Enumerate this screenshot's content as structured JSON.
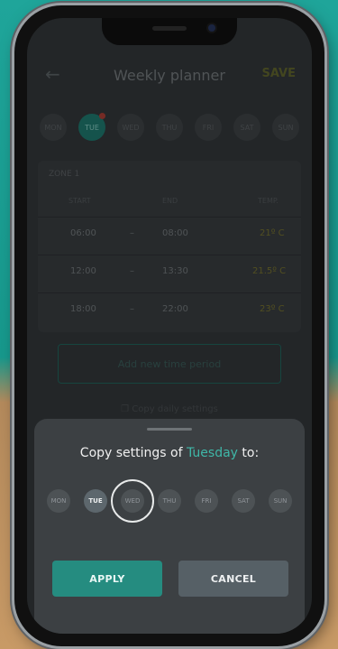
{
  "header": {
    "title": "Weekly planner",
    "back_icon": "arrow-left-icon",
    "save_label": "SAVE"
  },
  "days": [
    {
      "label": "MON",
      "active": false,
      "alert": false
    },
    {
      "label": "TUE",
      "active": true,
      "alert": true
    },
    {
      "label": "WED",
      "active": false,
      "alert": false
    },
    {
      "label": "THU",
      "active": false,
      "alert": false
    },
    {
      "label": "FRI",
      "active": false,
      "alert": false
    },
    {
      "label": "SAT",
      "active": false,
      "alert": false
    },
    {
      "label": "SUN",
      "active": false,
      "alert": false
    }
  ],
  "zone": {
    "label": "ZONE 1",
    "columns": [
      "START",
      "END",
      "TEMP."
    ],
    "periods": [
      {
        "start": "06:00",
        "sep": "–",
        "end": "08:00",
        "temp": "21º C"
      },
      {
        "start": "12:00",
        "sep": "–",
        "end": "13:30",
        "temp": "21.5º C"
      },
      {
        "start": "18:00",
        "sep": "–",
        "end": "22:00",
        "temp": "23º C"
      }
    ]
  },
  "add_period_label": "Add new time period",
  "copy_daily_label": "Copy daily settings",
  "sheet": {
    "title_prefix": "Copy settings of",
    "title_day": "Tuesday",
    "title_suffix": "to:",
    "days": [
      {
        "label": "MON",
        "state": "default"
      },
      {
        "label": "TUE",
        "state": "selected"
      },
      {
        "label": "WED",
        "state": "focused"
      },
      {
        "label": "THU",
        "state": "default"
      },
      {
        "label": "FRI",
        "state": "default"
      },
      {
        "label": "SAT",
        "state": "default"
      },
      {
        "label": "SUN",
        "state": "default"
      }
    ],
    "apply_label": "APPLY",
    "cancel_label": "CANCEL"
  },
  "colors": {
    "accent": "#3fb7a8",
    "apply_bg": "#258c80",
    "cancel_bg": "#566066"
  }
}
